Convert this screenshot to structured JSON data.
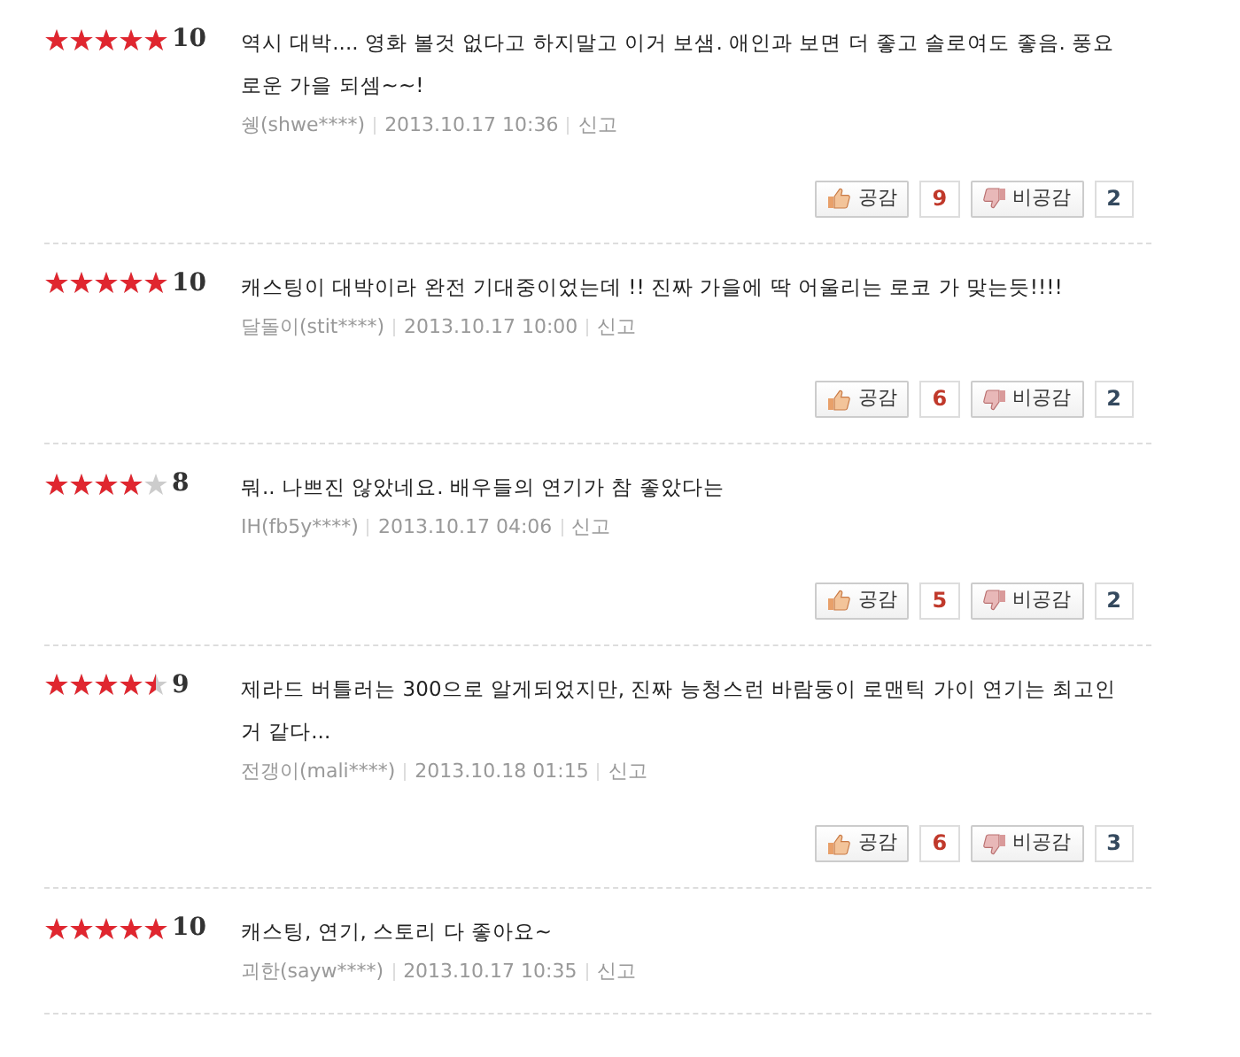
{
  "reviews": [
    {
      "stars": 5,
      "score": "10",
      "text": "역시 대박.... 영화 볼것 없다고 하지말고 이거 보샘. 애인과 보면 더 좋고 솔로여도 좋음. 풍요로운 가을 되셈~~!",
      "author": "쉥(shwe****)",
      "date": "2013.10.17 10:36",
      "report": "신고",
      "like_label": "공감",
      "likes": "9",
      "dislike_label": "비공감",
      "dislikes": "2"
    },
    {
      "stars": 5,
      "score": "10",
      "text": "캐스팅이 대박이라 완전 기대중이었는데 !! 진짜 가을에 딱 어울리는 로코 가 맞는듯!!!!",
      "author": "달돌이(stit****)",
      "date": "2013.10.17 10:00",
      "report": "신고",
      "like_label": "공감",
      "likes": "6",
      "dislike_label": "비공감",
      "dislikes": "2"
    },
    {
      "stars": 4,
      "score": "8",
      "text": "뭐.. 나쁘진 않았네요. 배우들의 연기가 참 좋았다는",
      "author": "IH(fb5y****)",
      "date": "2013.10.17 04:06",
      "report": "신고",
      "like_label": "공감",
      "likes": "5",
      "dislike_label": "비공감",
      "dislikes": "2"
    },
    {
      "stars": 4.5,
      "score": "9",
      "text": "제라드 버틀러는 300으로 알게되었지만, 진짜 능청스런 바람둥이 로맨틱 가이 연기는 최고인거 같다...",
      "author": "전갱이(mali****)",
      "date": "2013.10.18 01:15",
      "report": "신고",
      "like_label": "공감",
      "likes": "6",
      "dislike_label": "비공감",
      "dislikes": "3"
    },
    {
      "stars": 5,
      "score": "10",
      "text": "캐스팅, 연기, 스토리 다 좋아요~",
      "author": "괴한(sayw****)",
      "date": "2013.10.17 10:35",
      "report": "신고"
    }
  ]
}
